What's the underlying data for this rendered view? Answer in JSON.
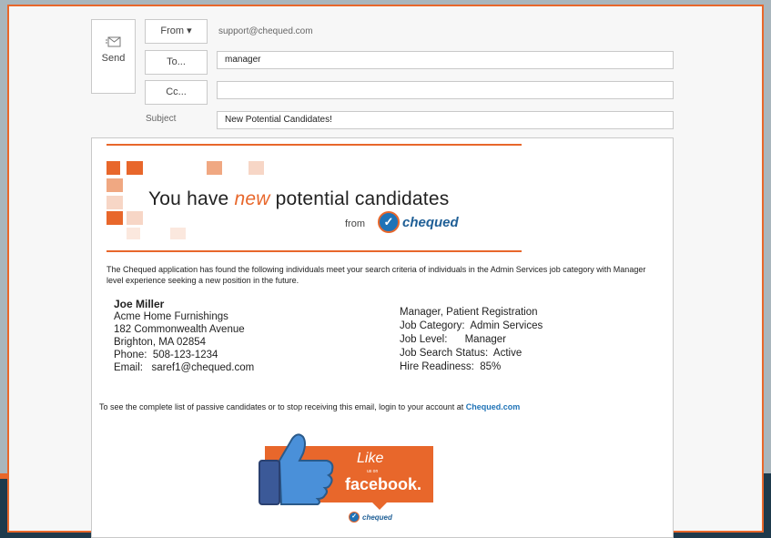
{
  "compose": {
    "send_label": "Send",
    "from_label": "From ▾",
    "from_value": "support@chequed.com",
    "to_label": "To...",
    "to_value": "manager",
    "cc_label": "Cc...",
    "cc_value": "",
    "subject_label": "Subject",
    "subject_value": "New Potential Candidates!"
  },
  "banner": {
    "title_before": "You have ",
    "title_new": "new",
    "title_after": " potential candidates",
    "from": "from",
    "logo_text": "chequed"
  },
  "email": {
    "intro": "The Chequed application has found the following individuals meet your search criteria of individuals in the Admin Services job category with Manager level experience seeking a new position in the future.",
    "footer_text": "To see the complete list of passive candidates or to stop receiving this email, login to your account at ",
    "footer_link": "Chequed.com"
  },
  "candidate": {
    "name": "Joe Miller",
    "company": "Acme Home Furnishings",
    "address1": "182 Commonwealth Avenue",
    "address2": "Brighton, MA 02854",
    "phone": "Phone:  508-123-1234",
    "email": "Email:   saref1@chequed.com",
    "title": "Manager, Patient Registration",
    "job_category": "Job Category:  Admin Services",
    "job_level": "Job Level:      Manager",
    "search_status": "Job Search Status:  Active",
    "hire_readiness": "Hire Readiness:  85%"
  },
  "facebook": {
    "like": "Like",
    "us_on": "us on",
    "brand": "facebook.",
    "bottom_logo": "chequed"
  },
  "colors": {
    "accent": "#e8672b",
    "brand_blue": "#1f73b7",
    "facebook_blue": "#3b5998"
  }
}
